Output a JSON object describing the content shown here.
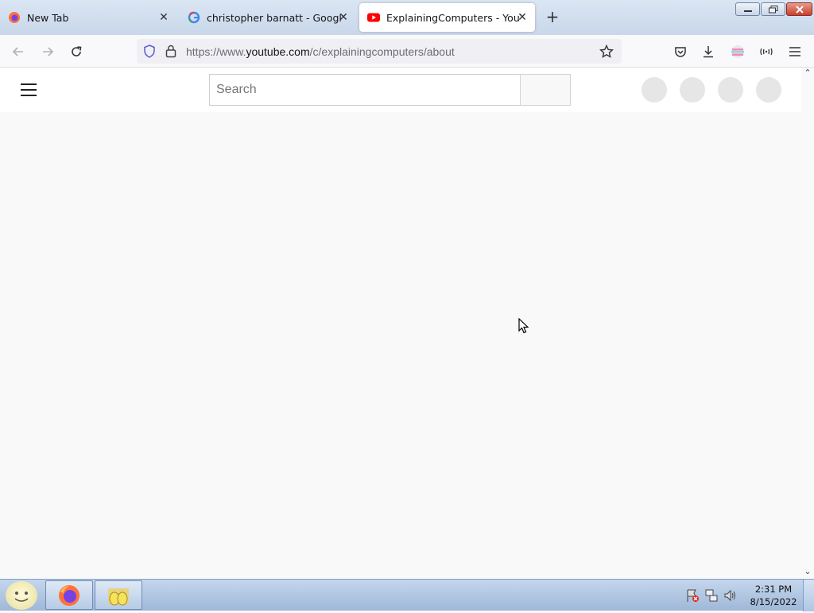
{
  "browser": {
    "tabs": [
      {
        "title": "New Tab",
        "icon": "firefox-icon"
      },
      {
        "title": "christopher barnatt - Google Se",
        "icon": "google-icon"
      },
      {
        "title": "ExplainingComputers - YouTube",
        "icon": "youtube-icon",
        "active": true
      }
    ],
    "url": {
      "prefix": "https://www.",
      "host": "youtube.com",
      "path": "/c/explainingcomputers/about"
    }
  },
  "youtube": {
    "search_placeholder": "Search"
  },
  "taskbar": {
    "time": "2:31 PM",
    "date": "8/15/2022"
  },
  "colors": {
    "youtube_red": "#ff0000",
    "page_bg": "#f9f9f9",
    "taskbar": "#b6cbe6"
  }
}
